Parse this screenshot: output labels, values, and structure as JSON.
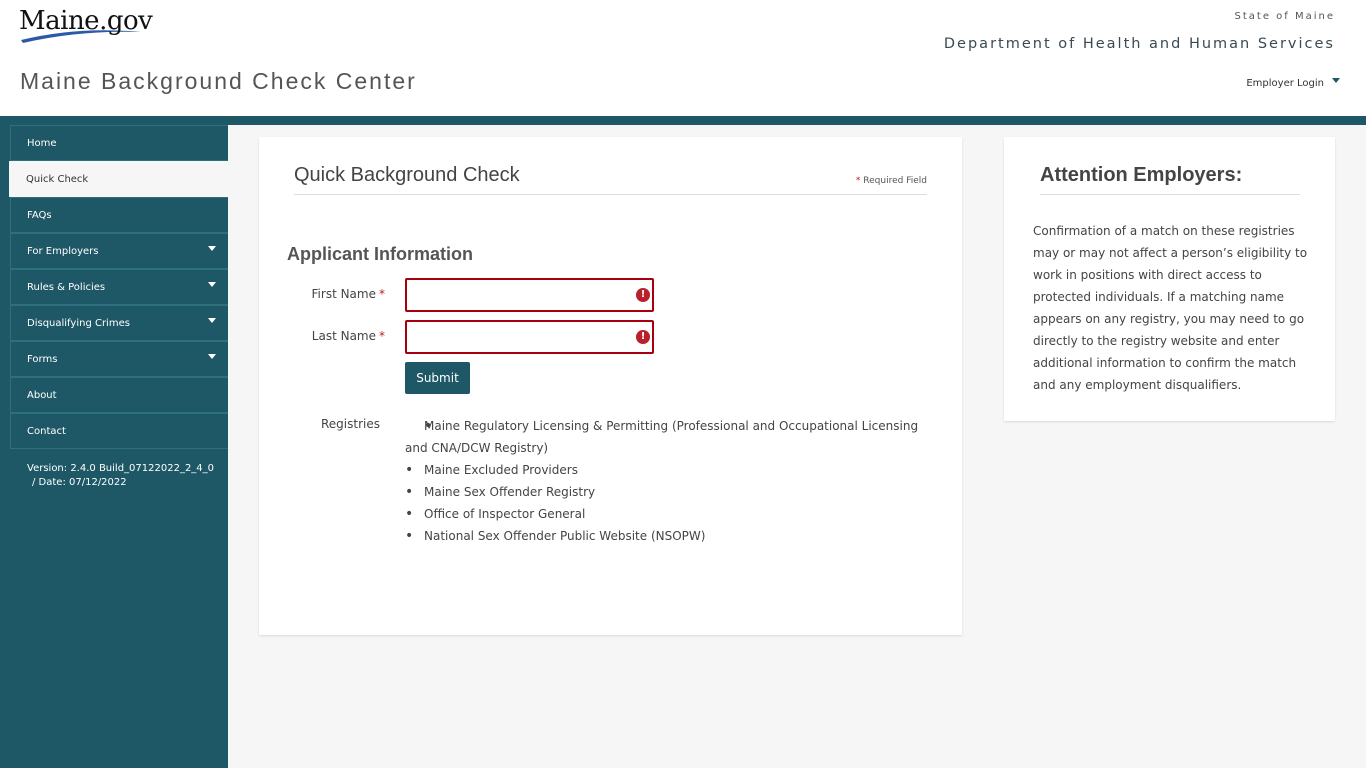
{
  "header": {
    "logo_text": "Maine.gov",
    "site_title": "Maine Background Check Center",
    "state_label": "State of Maine",
    "department": "Department of Health and Human Services",
    "employer_login": "Employer Login"
  },
  "sidebar": {
    "items": [
      {
        "label": "Home",
        "has_dropdown": false,
        "active": false
      },
      {
        "label": "Quick Check",
        "has_dropdown": false,
        "active": true
      },
      {
        "label": "FAQs",
        "has_dropdown": false,
        "active": false
      },
      {
        "label": "For Employers",
        "has_dropdown": true,
        "active": false
      },
      {
        "label": "Rules & Policies",
        "has_dropdown": true,
        "active": false
      },
      {
        "label": "Disqualifying Crimes",
        "has_dropdown": true,
        "active": false
      },
      {
        "label": "Forms",
        "has_dropdown": true,
        "active": false
      },
      {
        "label": "About",
        "has_dropdown": false,
        "active": false
      },
      {
        "label": "Contact",
        "has_dropdown": false,
        "active": false
      }
    ],
    "version_line1": "Version: 2.4.0 Build_07122022_2_4_0",
    "version_line2": "/   Date: 07/12/2022"
  },
  "main": {
    "title": "Quick Background Check",
    "required_star": "*",
    "required_label": "Required Field",
    "section_title": "Applicant Information",
    "fields": [
      {
        "label": "First Name",
        "required": "*",
        "value": "",
        "placeholder": "",
        "error_icon": "!"
      },
      {
        "label": "Last Name",
        "required": "*",
        "value": "",
        "placeholder": "",
        "error_icon": "!"
      }
    ],
    "submit_label": "Submit",
    "registries_label": "Registries",
    "registries": [
      "Maine Regulatory Licensing & Permitting (Professional and Occupational Licensing and CNA/DCW Registry)",
      "Maine Excluded Providers",
      "Maine Sex Offender Registry",
      "Office of Inspector General",
      "National Sex Offender Public Website (NSOPW)"
    ]
  },
  "side": {
    "title": "Attention Employers:",
    "text": "Confirmation of a match on these registries may or may not affect a person’s eligibility to work in positions with direct access to protected individuals. If a matching name appears on any registry, you may need to go directly to the registry website and enter additional information to confirm the match and any employment disqualifiers."
  },
  "colors": {
    "brand": "#1e5866",
    "error": "#a8000e",
    "background": "#f6f6f6"
  }
}
